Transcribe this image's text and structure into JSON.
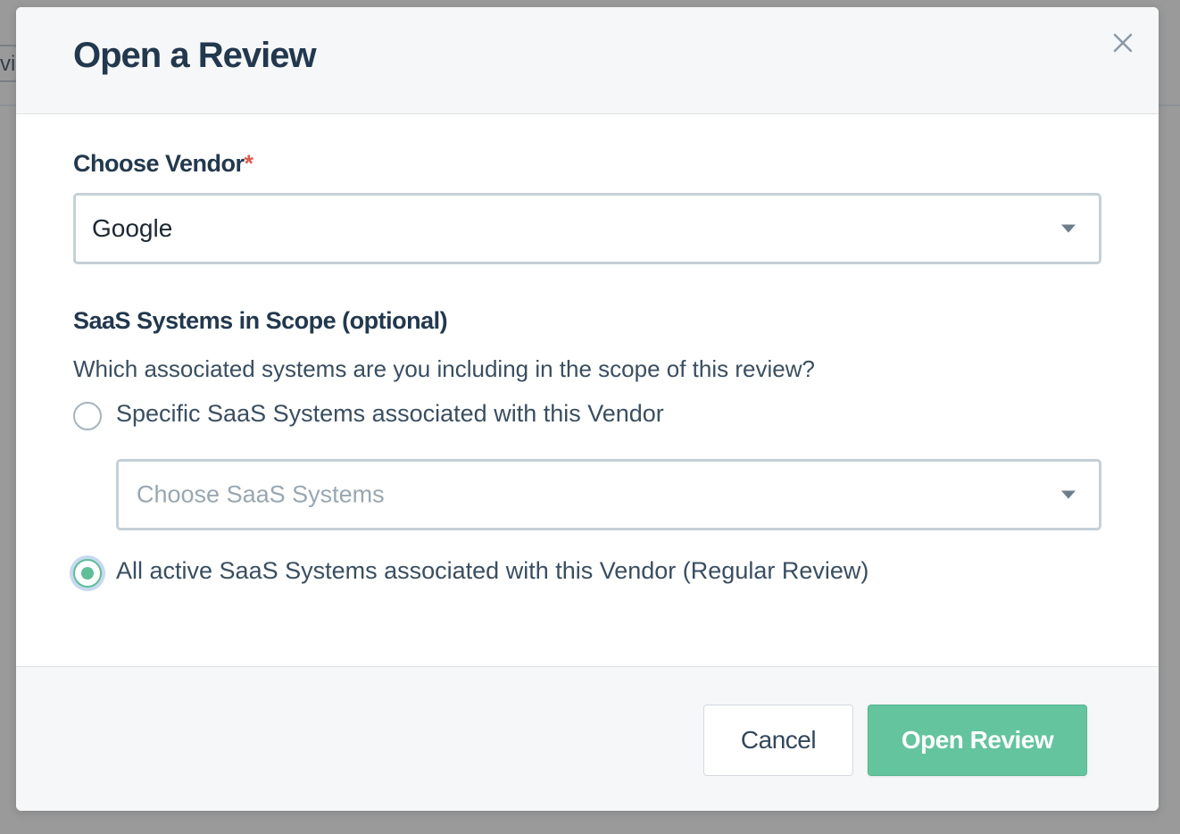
{
  "background": {
    "tab_fragment": "vie"
  },
  "modal": {
    "title": "Open a Review",
    "close_icon": "close-icon",
    "vendor": {
      "label": "Choose Vendor",
      "required_mark": "*",
      "selected_value": "Google"
    },
    "scope": {
      "label": "SaaS Systems in Scope (optional)",
      "question": "Which associated systems are you including in the scope of this review?",
      "options": [
        {
          "label": "Specific SaaS Systems associated with this Vendor",
          "checked": false
        },
        {
          "label": "All active SaaS Systems associated with this Vendor (Regular Review)",
          "checked": true
        }
      ],
      "systems_select_placeholder": "Choose SaaS Systems"
    },
    "footer": {
      "cancel_label": "Cancel",
      "submit_label": "Open Review"
    }
  },
  "colors": {
    "accent": "#63c49e",
    "title": "#22384e",
    "required": "#e05a4e"
  }
}
